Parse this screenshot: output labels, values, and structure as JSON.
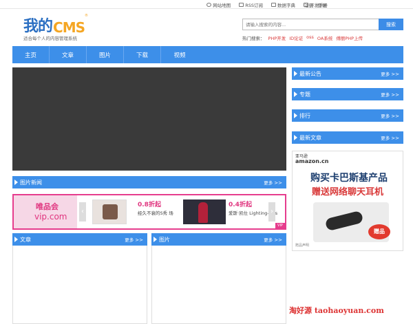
{
  "topbar": {
    "links": [
      {
        "label": "网站地图",
        "icon": "sitemap-icon"
      },
      {
        "label": "RSS订阅",
        "icon": "rss-icon"
      },
      {
        "label": "数据字典",
        "icon": "book-icon"
      },
      {
        "label": "开发手册",
        "icon": "document-icon"
      }
    ],
    "register": "注册",
    "login": "登录"
  },
  "logo": {
    "cn": "我的",
    "en": "CMS",
    "reg": "®"
  },
  "tagline": "适合每个人的内容管理系统",
  "search": {
    "placeholder": "请输入搜索的内容...",
    "button": "搜索"
  },
  "hot": {
    "label": "热门搜索：",
    "keywords": [
      "PHP开发",
      "ID论证",
      "oss",
      "OA系统",
      "傅丽PHP上传"
    ]
  },
  "nav": [
    "主页",
    "文章",
    "图片",
    "下载",
    "视频"
  ],
  "sections": {
    "image_news": "图片新闻",
    "articles": "文章",
    "pictures": "图片",
    "latest_notice": "最新公告",
    "topics": "专题",
    "ranking": "排行",
    "latest_articles": "最新文章"
  },
  "more": "更多",
  "more_arrows": ">>",
  "ad": {
    "vip_name": "唯品会",
    "vip_domain": "vip.com",
    "items": [
      {
        "discount": "0.8折起",
        "desc": "经久不衰的S秀 场"
      },
      {
        "discount": "0.4折起",
        "desc": "爱斯·凯仕 Lighting-kiss"
      }
    ],
    "tag": "VIP"
  },
  "amazon": {
    "brand_cn": "亚马逊",
    "brand_en": "amazon.cn",
    "headline1": "购买卡巴斯基产品",
    "headline2": "赠送网络聊天耳机",
    "gift": "赠品",
    "footer": "赠品声明"
  },
  "watermark": "淘好源 taohaoyuan.com",
  "colors": {
    "accent": "#3d8fe9",
    "ad_pink": "#e63c8d",
    "hot_red": "#d93a3a"
  }
}
